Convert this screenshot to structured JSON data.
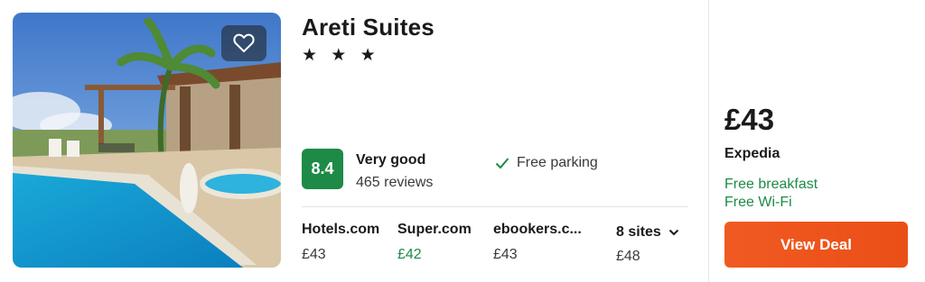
{
  "hotel": {
    "name": "Areti Suites",
    "stars": "★ ★ ★",
    "score": "8.4",
    "rating_label": "Very good",
    "reviews": "465 reviews",
    "amenity": "Free parking"
  },
  "sites": [
    {
      "name": "Hotels.com",
      "price": "£43"
    },
    {
      "name": "Super.com",
      "price": "£42"
    },
    {
      "name": "ebookers.c...",
      "price": "£43"
    }
  ],
  "more_sites": {
    "label": "8 sites",
    "price": "£48"
  },
  "deal": {
    "price": "£43",
    "provider": "Expedia",
    "perks": [
      "Free breakfast",
      "Free Wi-Fi"
    ],
    "button": "View Deal"
  },
  "colors": {
    "score_bg": "#1e8a47",
    "best_price": "#1e8a47",
    "perk_text": "#1e8a47",
    "deal_button": "#ea4f16"
  },
  "icons": {
    "favorite": "heart-icon",
    "amenity": "check-icon",
    "expand": "chevron-down-icon"
  }
}
